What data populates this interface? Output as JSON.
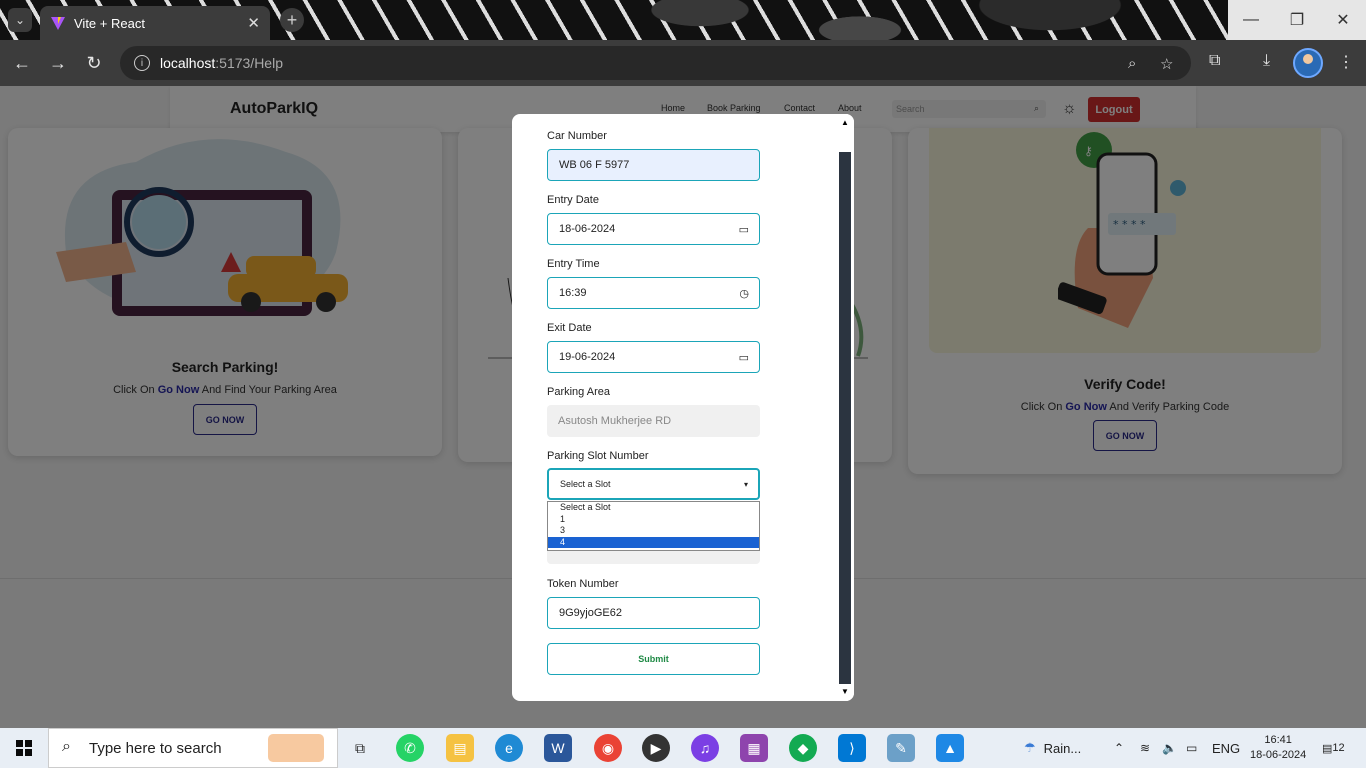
{
  "browser": {
    "tab_title": "Vite + React",
    "tab_close": "✕",
    "new_tab": "+",
    "url_host": "localhost",
    "url_path": ":5173/Help",
    "window_controls": [
      "—",
      "❐",
      "✕"
    ]
  },
  "navbar": {
    "brand": "AutoParkIQ",
    "links": [
      "Home",
      "Book Parking",
      "Contact",
      "About"
    ],
    "search_placeholder": "Search",
    "logout": "Logout"
  },
  "cards": [
    {
      "title": "Search Parking!",
      "text_before": "Click On ",
      "link": "Go Now",
      "text_after": " And Find Your Parking Area",
      "button": "GO NOW"
    },
    {
      "title": "Verify Code!",
      "text_before": "Click On ",
      "link": "Go Now",
      "text_after": " And Verify Parking Code",
      "button": "GO NOW"
    }
  ],
  "form": {
    "car_number_label": "Car Number",
    "car_number_value": "WB 06 F 5977",
    "entry_date_label": "Entry Date",
    "entry_date_value": "18-06-2024",
    "entry_time_label": "Entry Time",
    "entry_time_value": "16:39",
    "exit_date_label": "Exit Date",
    "exit_date_value": "19-06-2024",
    "parking_area_label": "Parking Area",
    "parking_area_value": "Asutosh Mukherjee RD",
    "slot_label": "Parking Slot Number",
    "slot_value": "Select a Slot",
    "slot_options": [
      "Select a Slot",
      "1",
      "3",
      "4"
    ],
    "slot_highlighted": "4",
    "token_label": "Token Number",
    "token_value": "9G9yjoGE62",
    "submit": "Submit"
  },
  "taskbar": {
    "search_placeholder": "Type here to search",
    "weather": "Rain...",
    "language": "ENG",
    "time": "16:41",
    "date": "18-06-2024",
    "notifications": "12"
  }
}
